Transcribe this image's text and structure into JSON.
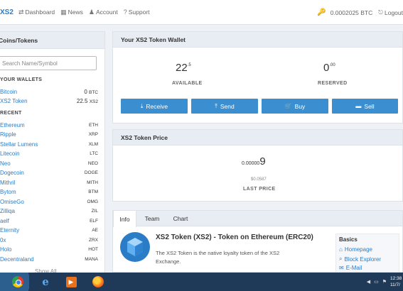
{
  "navbar": {
    "brand": "XS2",
    "dashboard": "Dashboard",
    "news": "News",
    "account": "Account",
    "support": "Support",
    "btc_balance": "0.0002025 BTC",
    "logout": "Logout",
    "icons": {
      "dashboard": "⇄",
      "news": "▦",
      "account": "♟",
      "support": "?",
      "key": "🔑",
      "logout": "⎋"
    }
  },
  "sidebar": {
    "title": "Coins/Tokens",
    "search_placeholder": "Search Name/Symbol",
    "wallets_title": "YOUR WALLETS",
    "wallets": [
      {
        "name": "Bitcoin",
        "amount": "0",
        "symbol": "BTC"
      },
      {
        "name": "XS2 Token",
        "amount": "22.5",
        "symbol": "XS2"
      }
    ],
    "recent_title": "RECENT",
    "recent": [
      {
        "name": "Ethereum",
        "symbol": "ETH"
      },
      {
        "name": "Ripple",
        "symbol": "XRP"
      },
      {
        "name": "Stellar Lumens",
        "symbol": "XLM"
      },
      {
        "name": "Litecoin",
        "symbol": "LTC"
      },
      {
        "name": "Neo",
        "symbol": "NEO"
      },
      {
        "name": "Dogecoin",
        "symbol": "DOGE"
      },
      {
        "name": "Mithril",
        "symbol": "MITH"
      },
      {
        "name": "Bytom",
        "symbol": "BTM"
      },
      {
        "name": "OmiseGo",
        "symbol": "OMG"
      },
      {
        "name": "Zilliqa",
        "symbol": "ZIL"
      },
      {
        "name": "aelf",
        "symbol": "ELF"
      },
      {
        "name": "Eternity",
        "symbol": "AE"
      },
      {
        "name": "0x",
        "symbol": "ZRX"
      },
      {
        "name": "Holo",
        "symbol": "HOT"
      },
      {
        "name": "Decentraland",
        "symbol": "MANA"
      }
    ],
    "show_all": "Show All"
  },
  "wallet": {
    "title": "Your XS2 Token Wallet",
    "available_int": "22",
    "available_dec": ".5",
    "available_label": "AVAILABLE",
    "reserved_int": "0",
    "reserved_dec": ".00",
    "reserved_label": "RESERVED",
    "buttons": {
      "receive": "Receive",
      "send": "Send",
      "buy": "Buy",
      "sell": "Sell"
    },
    "button_icons": {
      "receive": "⤓",
      "send": "⤒",
      "buy": "🛒",
      "sell": "▬"
    }
  },
  "price": {
    "title": "XS2 Token Price",
    "value_small": "0.00000",
    "value_big": "9",
    "usd": "$0.0587",
    "label": "LAST PRICE"
  },
  "info": {
    "tabs": [
      "Info",
      "Team",
      "Chart"
    ],
    "token_title": "XS2 Token (XS2) - Token on Ethereum (ERC20)",
    "description": "The XS2 Token is the native loyalty token of the XS2 Exchange.",
    "basics": {
      "title": "Basics",
      "homepage": "Homepage",
      "block_explorer": "Block Explorer",
      "email": "E-Mail",
      "icons": {
        "homepage": "⌂",
        "block_explorer": "⌕",
        "email": "✉"
      }
    }
  },
  "taskbar": {
    "time": "12:38",
    "date": "11/7/"
  },
  "colors": {
    "accent": "#2a7cc7",
    "button": "#3b8fd1",
    "panel_head": "#e8edf3",
    "taskbar": "#1e3a58"
  }
}
